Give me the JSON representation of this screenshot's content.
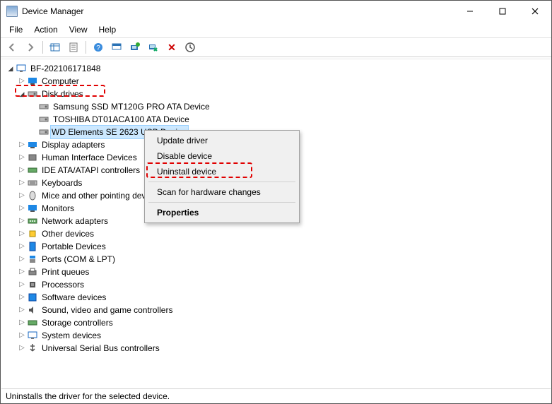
{
  "window": {
    "title": "Device Manager"
  },
  "menubar": {
    "file": "File",
    "action": "Action",
    "view": "View",
    "help": "Help"
  },
  "toolbar_icons": {
    "back": "back-arrow-icon",
    "forward": "forward-arrow-icon",
    "show_hidden": "show-hidden-icon",
    "properties": "properties-sheet-icon",
    "help": "help-icon",
    "console": "console-icon",
    "update_driver": "update-driver-icon",
    "uninstall_pc": "uninstall-pc-icon",
    "uninstall_x": "uninstall-x-icon",
    "scan": "scan-hardware-icon"
  },
  "tree": {
    "root": "BF-202106171848",
    "computer": "Computer",
    "disk_drives": "Disk drives",
    "disks": {
      "samsung": "Samsung SSD MT120G PRO ATA Device",
      "toshiba": "TOSHIBA DT01ACA100 ATA Device",
      "wd": "WD Elements SE 2623 USB Device"
    },
    "categories": [
      "Display adapters",
      "Human Interface Devices",
      "IDE ATA/ATAPI controllers",
      "Keyboards",
      "Mice and other pointing devices",
      "Monitors",
      "Network adapters",
      "Other devices",
      "Portable Devices",
      "Ports (COM & LPT)",
      "Print queues",
      "Processors",
      "Software devices",
      "Sound, video and game controllers",
      "Storage controllers",
      "System devices",
      "Universal Serial Bus controllers"
    ]
  },
  "context_menu": {
    "update": "Update driver",
    "disable": "Disable device",
    "uninstall": "Uninstall device",
    "scan": "Scan for hardware changes",
    "properties": "Properties"
  },
  "statusbar": {
    "text": "Uninstalls the driver for the selected device."
  }
}
